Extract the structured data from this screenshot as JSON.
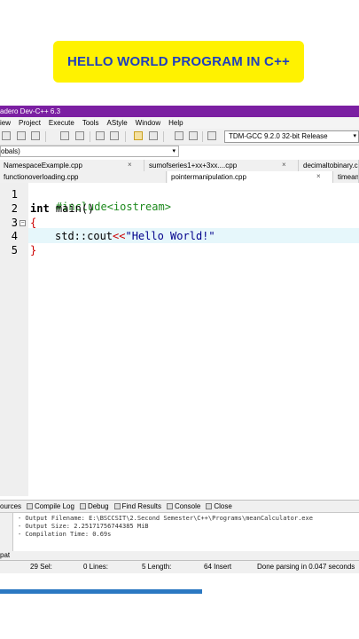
{
  "banner": {
    "text": "HELLO WORLD PROGRAM IN C++"
  },
  "window": {
    "title": "adero Dev-C++ 6.3"
  },
  "menu": {
    "items": [
      "iew",
      "Project",
      "Execute",
      "Tools",
      "AStyle",
      "Window",
      "Help"
    ]
  },
  "toolbar": {
    "compiler": "TDM-GCC 9.2.0 32-bit Release"
  },
  "scope": {
    "value": "obals)"
  },
  "tabs_row1": [
    {
      "label": "NamespaceExample.cpp"
    },
    {
      "label": "sumofseries1+xx+3xx....cpp"
    },
    {
      "label": "decimaltobinary.cp"
    }
  ],
  "tabs_row2": [
    {
      "label": "functionoverloading.cpp"
    },
    {
      "label": "pointermanipulation.cpp"
    },
    {
      "label": "timeam"
    }
  ],
  "editor": {
    "line_numbers": [
      "1",
      "2",
      "3",
      "4",
      "5"
    ],
    "line1": "#include<iostream>",
    "line2_kw": "int",
    "line2_rest": " main()",
    "line3": "{",
    "line4_a": "std::cout",
    "line4_op": "<<",
    "line4_str": "\"Hello World!\"",
    "line5": "}"
  },
  "bottom_tabs": [
    "ources",
    "Compile Log",
    "Debug",
    "Find Results",
    "Console",
    "Close"
  ],
  "compile_log": [
    "- Output Filename: E:\\BSCCSIT\\2.Second Semester\\C++\\Programs\\meanCalculator.exe",
    "- Output Size: 2.25171756744385 MiB",
    "- Compilation Time: 0.69s"
  ],
  "pat_label": "pat",
  "status": {
    "sel": "29  Sel:",
    "lines": "0  Lines:",
    "length": "5  Length:",
    "insert": "64  Insert",
    "parsing": "Done parsing in 0.047 seconds"
  },
  "colors": {
    "banner_bg": "#fff200",
    "banner_text": "#1f3fbf",
    "titlebar": "#7b1fa2",
    "progress": "#2b78c2"
  }
}
